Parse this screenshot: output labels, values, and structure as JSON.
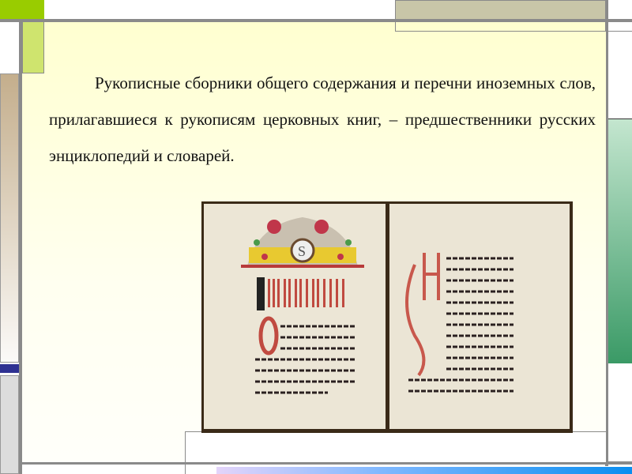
{
  "slide": {
    "paragraph": "Рукописные сборники общего содержания и перечни иноземных слов, прилагавшиеся к рукописям церковных книг, – предшественники русских энциклопедий и словарей."
  },
  "image": {
    "subject": "old-church-book-illustration"
  },
  "colors": {
    "accent_green": "#99cc00",
    "light_green": "#cce670",
    "tan": "#c8c4a8",
    "frame_gray": "#808080",
    "blue_bar": "#2e3192",
    "slide_bg": "#ffffd0"
  }
}
